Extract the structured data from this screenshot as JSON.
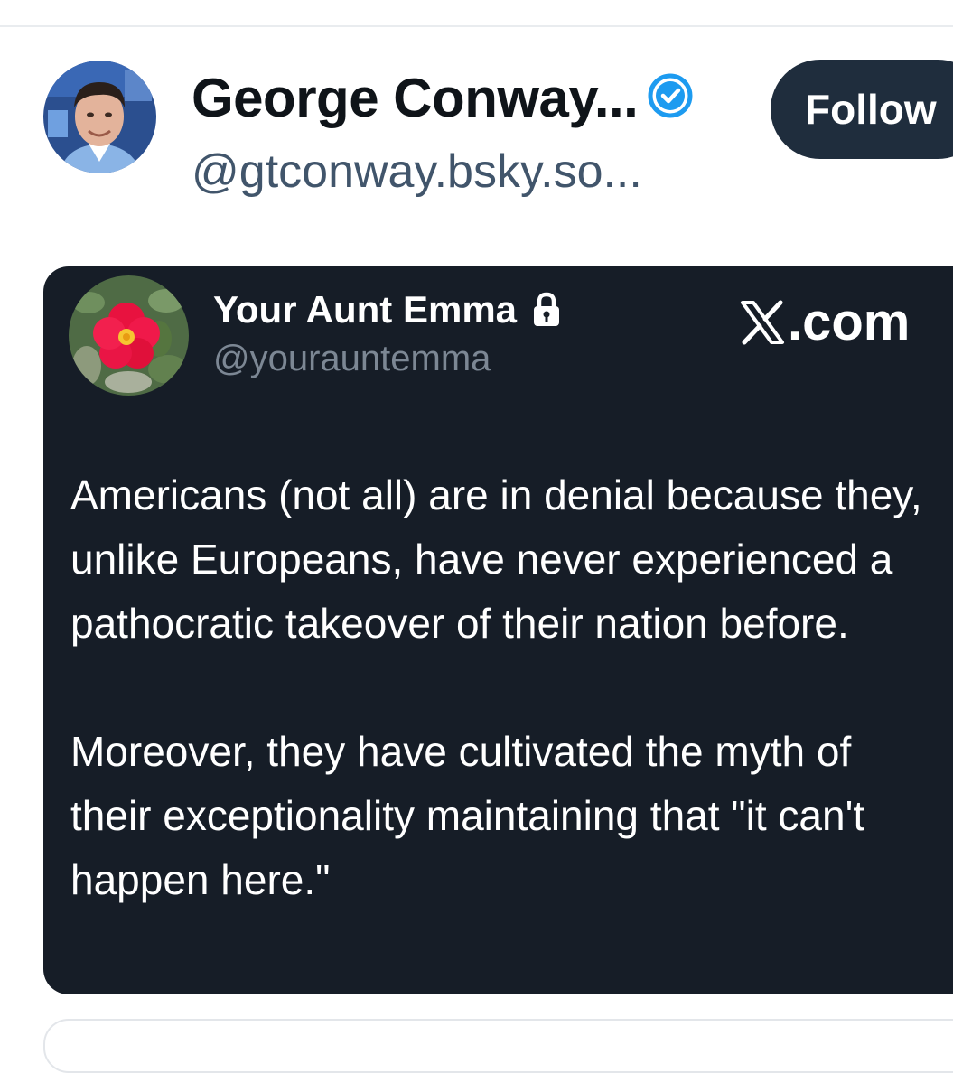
{
  "post": {
    "author": {
      "display_name": "George Conway...",
      "handle": "@gtconway.bsky.so...",
      "verified_icon": "verified-check-icon",
      "avatar_icon": "profile-photo"
    },
    "follow_label": "Follow"
  },
  "quoted_card": {
    "author": {
      "display_name": "Your Aunt Emma",
      "handle": "@yourauntemma",
      "lock_icon": "lock-icon",
      "avatar_icon": "red-flower-photo"
    },
    "source_label": ".com",
    "source_icon": "x-logo-icon",
    "paragraphs": [
      "Americans (not all) are in denial because they, unlike Europeans, have never experienced a pathocratic takeover of their nation before.",
      "Moreover, they have cultivated the myth of their exceptionality maintaining that \"it can't happen here.\""
    ]
  },
  "colors": {
    "card_background": "#161d27",
    "follow_button": "#1f2d3d",
    "verified_blue": "#1d9bf0",
    "handle_gray": "#41556b"
  }
}
